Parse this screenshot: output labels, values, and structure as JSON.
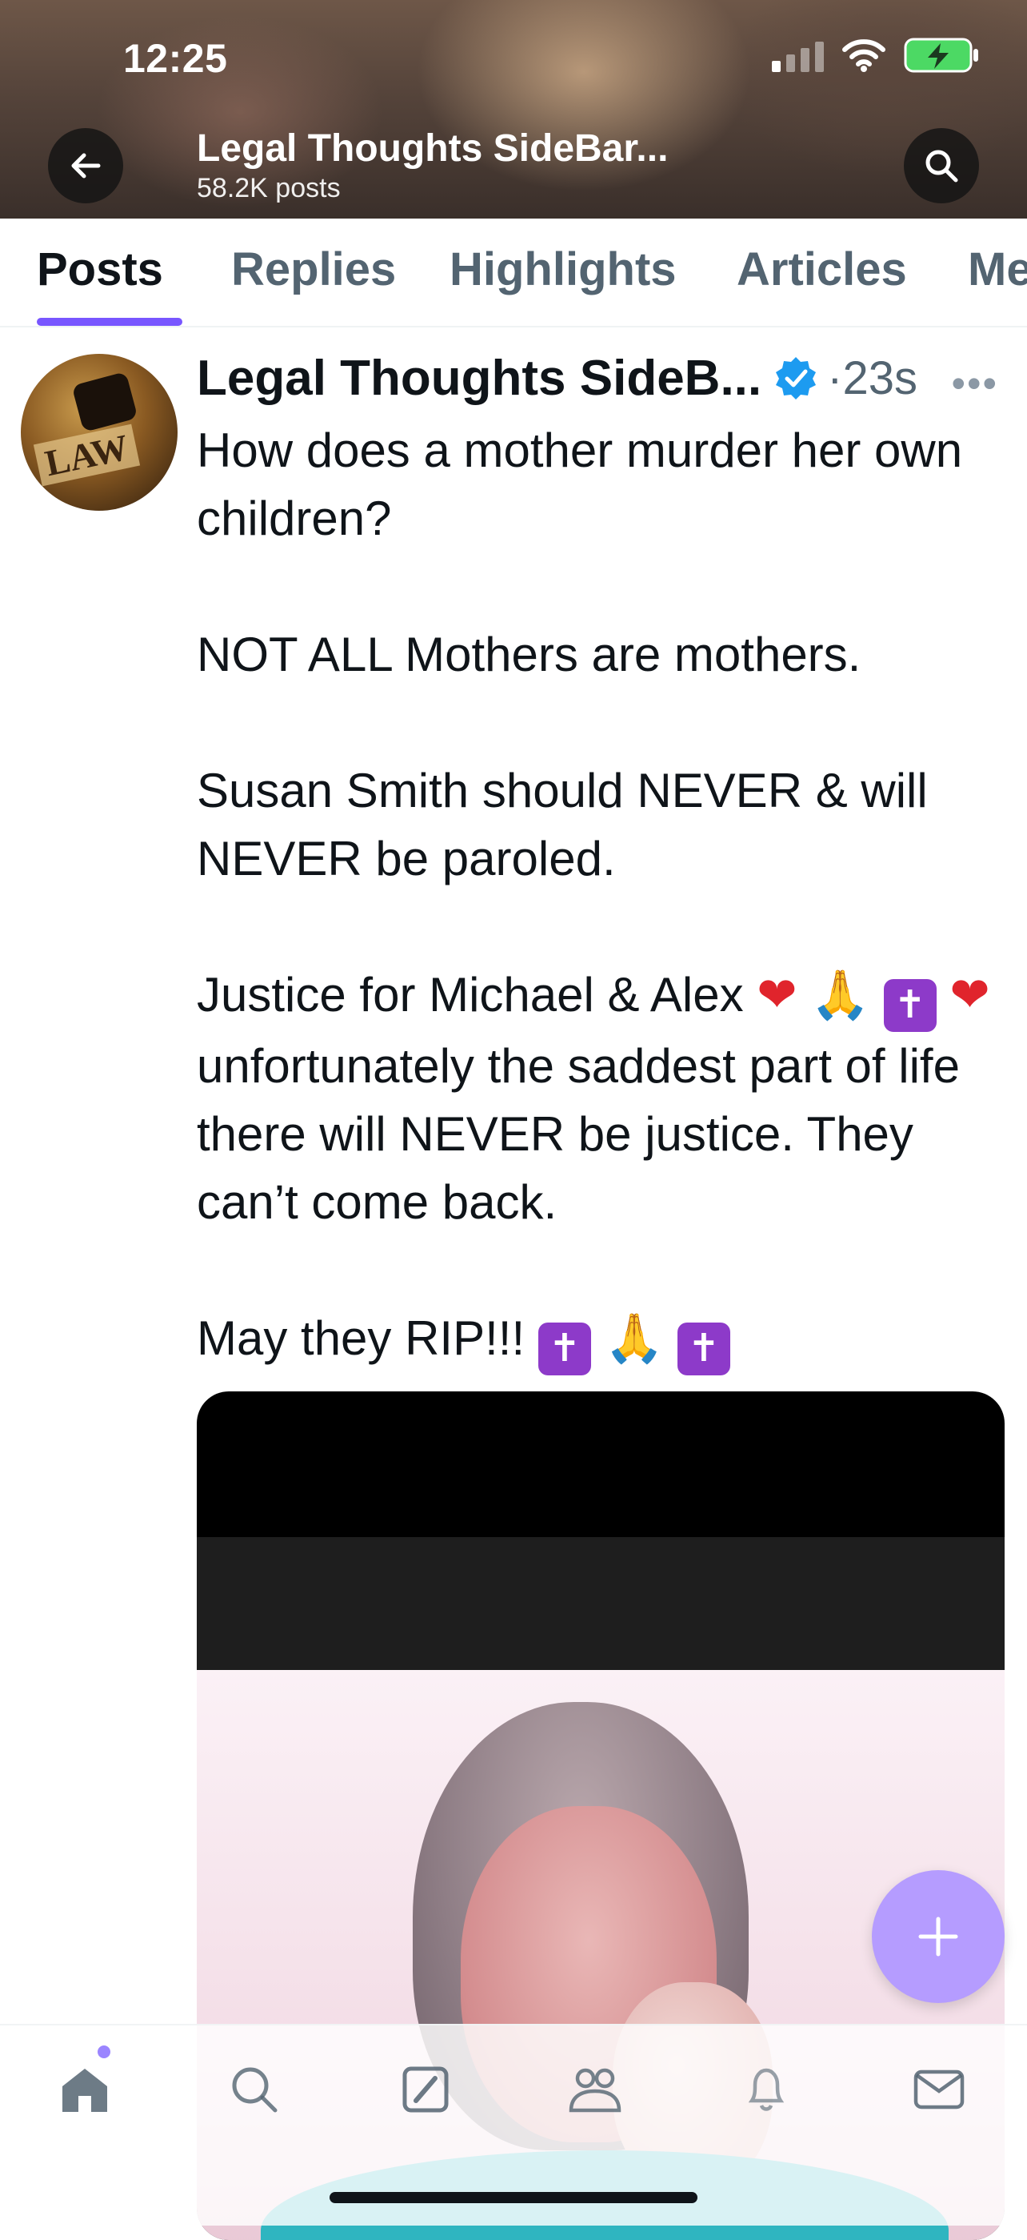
{
  "status_bar": {
    "time": "12:25"
  },
  "header": {
    "title": "Legal Thoughts SideBar...",
    "posts_count": "58.2K posts"
  },
  "tabs": [
    {
      "label": "Posts",
      "active": true
    },
    {
      "label": "Replies",
      "active": false
    },
    {
      "label": "Highlights",
      "active": false
    },
    {
      "label": "Articles",
      "active": false
    },
    {
      "label": "Me",
      "active": false
    }
  ],
  "post": {
    "author": "Legal Thoughts SideB...",
    "time": "·23s",
    "more_label": "•••",
    "avatar_text": "LAW",
    "lines": {
      "p1": "How does a mother murder her own children?",
      "p2": "NOT ALL Mothers are mothers.",
      "p3": "Susan Smith should NEVER & will NEVER be paroled.",
      "p4_a": "Justice for Michael & Alex",
      "p4_b": "unfortunately the saddest part of life there will NEVER be justice. They can’t come back.",
      "p5": "May they RIP!!!"
    }
  },
  "icons": {
    "back": "arrow-left-icon",
    "search": "search-icon",
    "verified": "verified-badge-icon",
    "compose": "plus-icon",
    "nav": [
      "home-icon",
      "search-icon",
      "grok-icon",
      "communities-icon",
      "bell-icon",
      "mail-icon"
    ]
  },
  "colors": {
    "accent": "#7856ff",
    "fab": "#b59cff",
    "verified": "#1d9bf0",
    "muted_text": "#536471"
  }
}
